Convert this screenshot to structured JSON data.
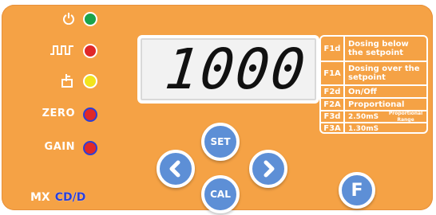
{
  "indicators": [
    {
      "symbol": "power-icon",
      "label": "",
      "led": "green"
    },
    {
      "symbol": "pulse-icon",
      "label": "",
      "led": "red"
    },
    {
      "symbol": "doser-icon",
      "label": "",
      "led": "yellow"
    },
    {
      "symbol": "",
      "label": "ZERO",
      "led": "redblue"
    },
    {
      "symbol": "",
      "label": "GAIN",
      "led": "redblue"
    }
  ],
  "display": {
    "value": "1000"
  },
  "legend": [
    {
      "code": "F1d",
      "desc": "Dosing below the setpoint"
    },
    {
      "code": "F1A",
      "desc": "Dosing over the setpoint"
    },
    {
      "code": "F2d",
      "desc": "On/Off"
    },
    {
      "code": "F2A",
      "desc": "Proportional"
    },
    {
      "code": "F3d",
      "desc": "2.50mS",
      "extra": "Proportional Range"
    },
    {
      "code": "F3A",
      "desc": "1.30mS"
    }
  ],
  "buttons": {
    "set": "SET",
    "cal": "CAL",
    "f": "F"
  },
  "brand": {
    "prefix": "MX",
    "model": "CD/D"
  },
  "colors": {
    "panel": "#f5a245",
    "button": "#5d8fd6",
    "led_green": "#1aa34a",
    "led_red": "#e02828",
    "led_yellow": "#f2e41c",
    "accent_blue": "#2b3fd8"
  }
}
